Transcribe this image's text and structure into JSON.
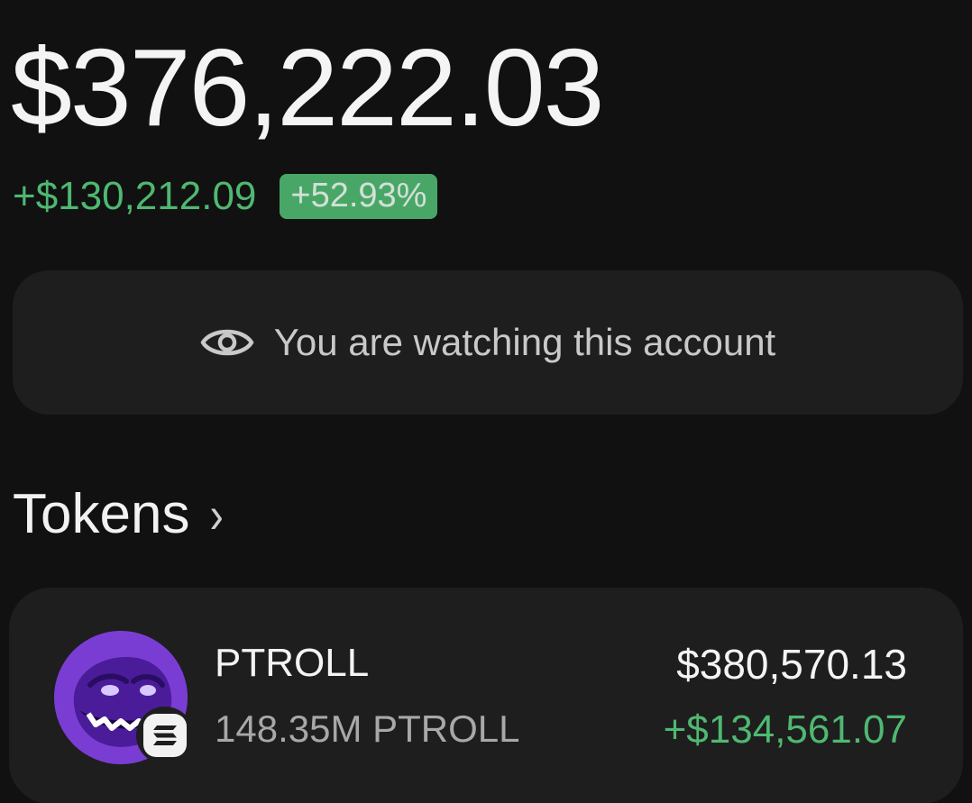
{
  "portfolio": {
    "balance": "$376,222.03",
    "change_amount": "+$130,212.09",
    "change_percent": "+52.93%"
  },
  "watch_banner": {
    "icon": "eye-icon",
    "text": "You are watching this account"
  },
  "tokens_section": {
    "title": "Tokens",
    "chevron": "›"
  },
  "tokens": [
    {
      "name": "PTROLL",
      "quantity": "148.35M PTROLL",
      "value": "$380,570.13",
      "pnl": "+$134,561.07",
      "avatar_color": "#7a3dd4",
      "chain_icon": "solana-icon"
    }
  ],
  "colors": {
    "background": "#111111",
    "card": "#1e1e1e",
    "positive": "#4fb871"
  }
}
